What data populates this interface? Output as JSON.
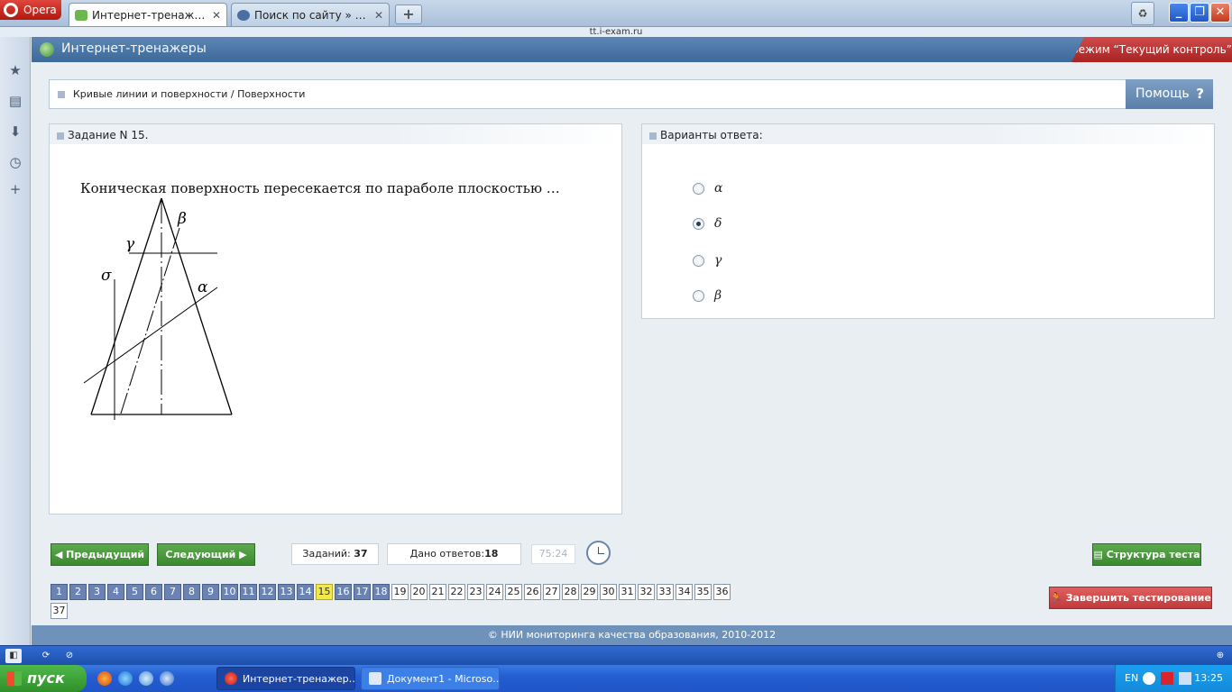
{
  "browser": {
    "menu_label": "Opera",
    "tabs": [
      {
        "label": "Интернет-тренажеры",
        "close": "✕"
      },
      {
        "label": "Поиск по сайту » Отве…",
        "close": "✕"
      }
    ],
    "new_tab": "+",
    "url": "tt.i-exam.ru"
  },
  "header": {
    "title": "Интернет-тренажеры",
    "mode": "режим “Текущий контроль”"
  },
  "breadcrumb": "Кривые линии и поверхности / Поверхности",
  "help": {
    "label": "Помощь",
    "icon": "?"
  },
  "task": {
    "title": "Задание N 15.",
    "question": "Коническая поверхность пересекается по параболе плоскостью …",
    "figure_labels": {
      "beta": "β",
      "gamma": "γ",
      "sigma": "σ",
      "alpha": "α"
    }
  },
  "answers": {
    "title": "Варианты ответа:",
    "options": [
      {
        "label": "α",
        "selected": false
      },
      {
        "label": "δ",
        "selected": true
      },
      {
        "label": "γ",
        "selected": false
      },
      {
        "label": "β",
        "selected": false
      }
    ]
  },
  "nav": {
    "prev": "Предыдущий",
    "next": "Следующий",
    "tasks_label": "Заданий:",
    "tasks_count": "37",
    "answered_label": "Дано ответов:",
    "answered_count": "18",
    "timer": "75:24",
    "structure": "Структура теста",
    "finish": "Завершить тестирование"
  },
  "task_grid": {
    "total": 37,
    "current": 15,
    "done": [
      1,
      2,
      3,
      4,
      5,
      6,
      7,
      8,
      9,
      10,
      11,
      12,
      13,
      14,
      16,
      17,
      18
    ]
  },
  "footer": "© НИИ мониторинга качества образования, 2010-2012",
  "taskbar": {
    "start": "пуск",
    "windows": [
      {
        "label": "Интернет-тренажер…",
        "active": true
      },
      {
        "label": "Документ1 - Microso…",
        "active": false
      }
    ],
    "lang": "EN",
    "time": "13:25"
  },
  "colors": {
    "done_cell": "#6a83b3",
    "current_cell": "#f1e84a",
    "green_button": "#4a9a3f",
    "red_button": "#d04c4c",
    "header_blue": "#4a77a8"
  }
}
